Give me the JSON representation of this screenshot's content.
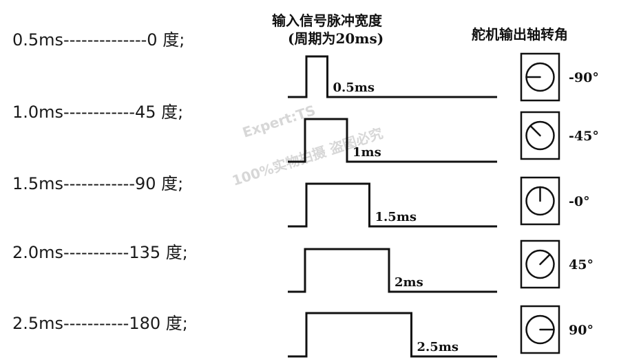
{
  "mapping": [
    {
      "text": "0.5ms--------------0 度;"
    },
    {
      "text": "1.0ms------------45 度;"
    },
    {
      "text": "1.5ms------------90 度;"
    },
    {
      "text": "2.0ms-----------135 度;"
    },
    {
      "text": "2.5ms-----------180 度;"
    }
  ],
  "titles": {
    "input_line1": "输入信号脉冲宽度",
    "input_line2": "(周期为20ms)",
    "output": "舵机输出轴转角"
  },
  "pulses": [
    {
      "label": "0.5ms",
      "width_ms": 0.5
    },
    {
      "label": "1ms",
      "width_ms": 1.0
    },
    {
      "label": "1.5ms",
      "width_ms": 1.5
    },
    {
      "label": "2ms",
      "width_ms": 2.0
    },
    {
      "label": "2.5ms",
      "width_ms": 2.5
    }
  ],
  "servo_angles": [
    {
      "label": "-90°",
      "angle_deg": -90
    },
    {
      "label": "-45°",
      "angle_deg": -45
    },
    {
      "label": "-0°",
      "angle_deg": 0
    },
    {
      "label": "45°",
      "angle_deg": 45
    },
    {
      "label": "90°",
      "angle_deg": 90
    }
  ],
  "watermark": {
    "line1": "Expert:TS",
    "line2": "100%实物拍摄 盗图必究"
  }
}
